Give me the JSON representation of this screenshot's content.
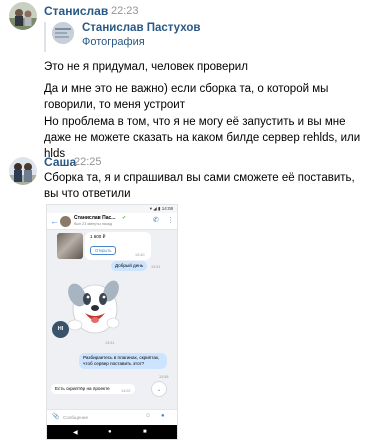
{
  "messages": [
    {
      "author": "Станислав",
      "time": "22:23",
      "forward": {
        "name": "Станислав Пастухов",
        "subtitle": "Фотография"
      },
      "paragraphs": [
        "Это не я придумал, человек проверил",
        "Да и мне это не важно) если сборка та, о которой мы говорили, то меня устроит",
        "Но проблема в том, что я не могу её запустить и вы мне даже не можете сказать на каком билде сервер rehlds, или hlds"
      ]
    },
    {
      "author": "Саша",
      "time": "22:25",
      "text": "Сборка та, я и спрашивал вы сами сможете её поставить, вы что ответили"
    }
  ],
  "phone": {
    "status_time": "14:08",
    "header_name": "Станислав Пас...",
    "header_sub": "был 23 минуты назад",
    "price": "1 600 ₽",
    "open_label": "Открыть",
    "time_1": "13:40",
    "greeting": "Добрый день",
    "time_2": "13:51",
    "sticker_text": "HI",
    "time_3": "13:51",
    "out_message": "Разбираетесь в плагинах, скриптах, чтоб сервер поставить этот?",
    "time_4": "13:58",
    "in_message": "Есть скриптёр на проекте",
    "time_5": "14:02",
    "input_placeholder": "Сообщение"
  }
}
